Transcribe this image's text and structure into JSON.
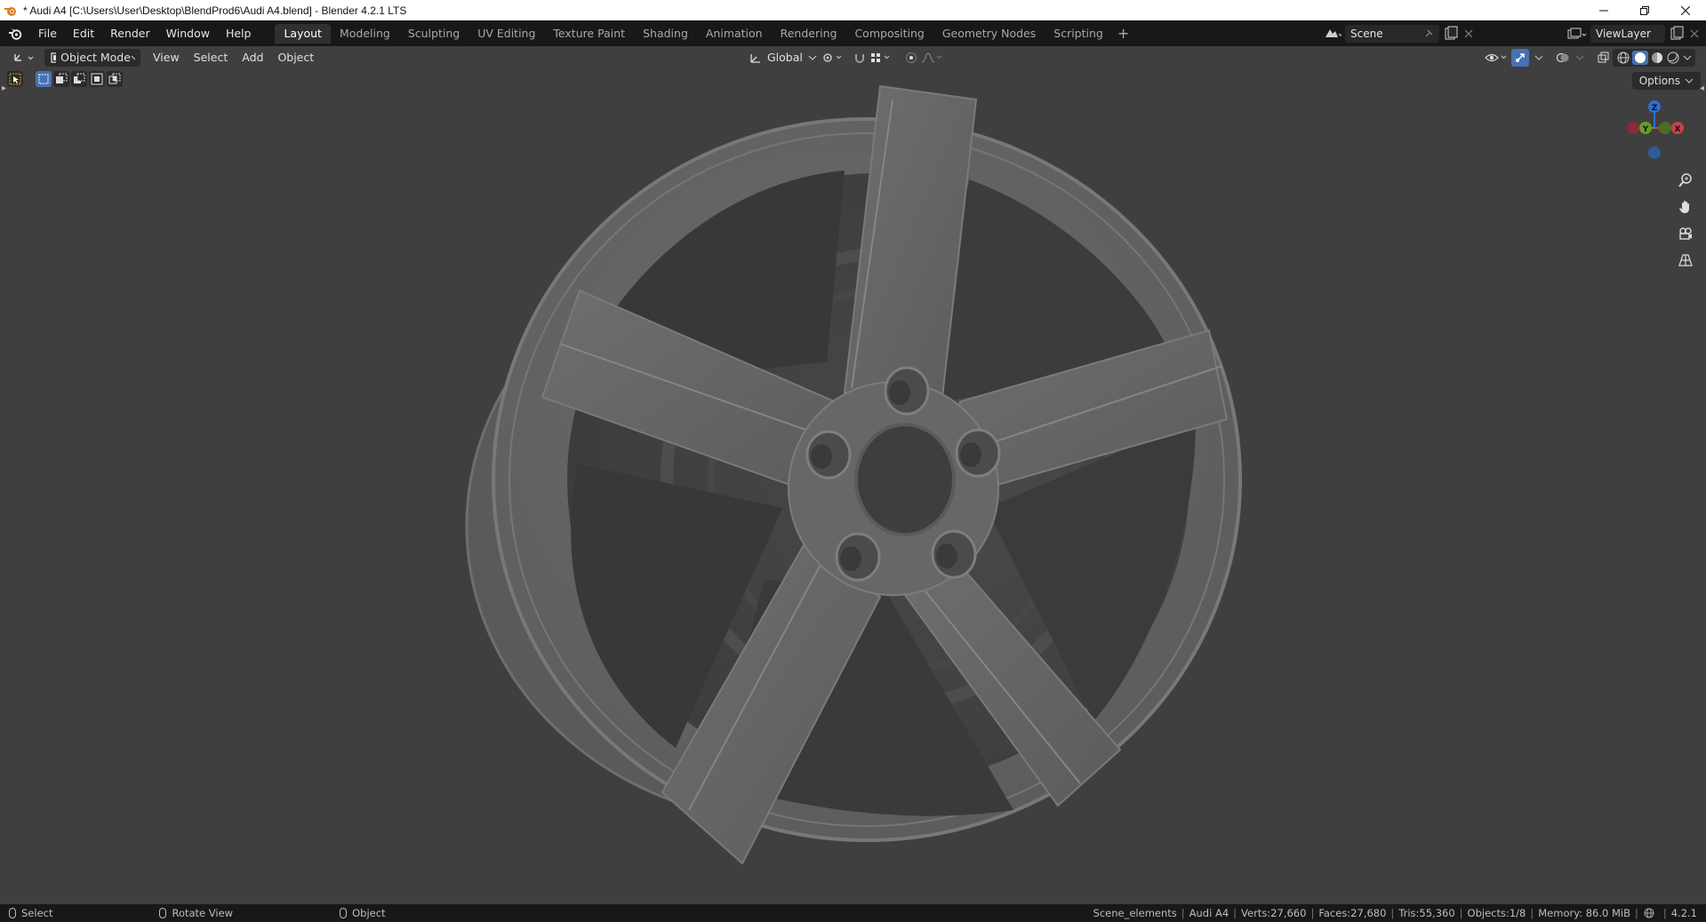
{
  "window": {
    "title": "* Audi A4 [C:\\Users\\User\\Desktop\\BlendProd6\\Audi A4.blend] - Blender 4.2.1 LTS"
  },
  "menu": {
    "file": "File",
    "edit": "Edit",
    "render": "Render",
    "window": "Window",
    "help": "Help"
  },
  "workspaces": [
    {
      "label": "Layout",
      "active": true
    },
    {
      "label": "Modeling",
      "active": false
    },
    {
      "label": "Sculpting",
      "active": false
    },
    {
      "label": "UV Editing",
      "active": false
    },
    {
      "label": "Texture Paint",
      "active": false
    },
    {
      "label": "Shading",
      "active": false
    },
    {
      "label": "Animation",
      "active": false
    },
    {
      "label": "Rendering",
      "active": false
    },
    {
      "label": "Compositing",
      "active": false
    },
    {
      "label": "Geometry Nodes",
      "active": false
    },
    {
      "label": "Scripting",
      "active": false
    }
  ],
  "add_workspace": "+",
  "scene": {
    "label": "Scene"
  },
  "view_layer": {
    "label": "ViewLayer"
  },
  "viewport_header": {
    "mode": "Object Mode",
    "view": "View",
    "select": "Select",
    "add": "Add",
    "object": "Object",
    "transform_orientation": "Global",
    "options": "Options"
  },
  "gizmo": {
    "x": "X",
    "y": "Y",
    "z": "Z"
  },
  "status": {
    "hint_select": "Select",
    "hint_rotate": "Rotate View",
    "hint_object": "Object",
    "collection": "Scene_elements",
    "object_name": "Audi A4",
    "verts": "Verts:27,660",
    "faces": "Faces:27,680",
    "tris": "Tris:55,360",
    "objects": "Objects:1/8",
    "memory": "Memory: 86.0 MiB",
    "version": "4.2.1"
  },
  "colors": {
    "accent_blue": "#4772b3",
    "axis_x": "#c8404e",
    "axis_y": "#6a9a2a",
    "axis_z": "#2e6fd0",
    "viewport_bg": "#3f3f3f"
  }
}
